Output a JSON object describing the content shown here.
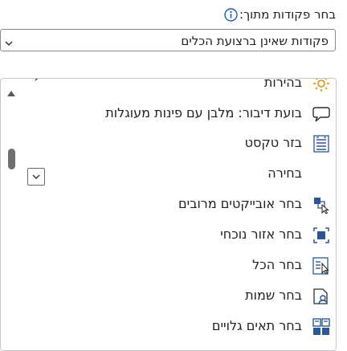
{
  "header": {
    "label": "בחר פקודות מתוך:"
  },
  "dropdown": {
    "value": "פקודות שאינן ברצועת הכלים"
  },
  "list": {
    "items": [
      {
        "label": "בהירות",
        "icon": "brightness-icon"
      },
      {
        "label": "בועת דיבור: מלבן עם פינות מעוגלות",
        "icon": "speech-bubble-icon"
      },
      {
        "label": "בזר טקסט",
        "icon": "text-distribute-icon"
      },
      {
        "label": "בחירה",
        "icon": "none"
      },
      {
        "label": "בחר אובייקטים מרובים",
        "icon": "select-multiple-objects-icon"
      },
      {
        "label": "בחר אזור נוכחי",
        "icon": "select-current-region-icon"
      },
      {
        "label": "בחר הכל",
        "icon": "select-all-icon"
      },
      {
        "label": "בחר שמות",
        "icon": "select-names-icon"
      },
      {
        "label": "בחר תאים גלויים",
        "icon": "select-visible-cells-icon"
      }
    ]
  },
  "colors": {
    "accent": "#1a5fb4",
    "icon_blue": "#2b5797",
    "text": "#1f1f1f",
    "border": "#8a8a8a"
  }
}
